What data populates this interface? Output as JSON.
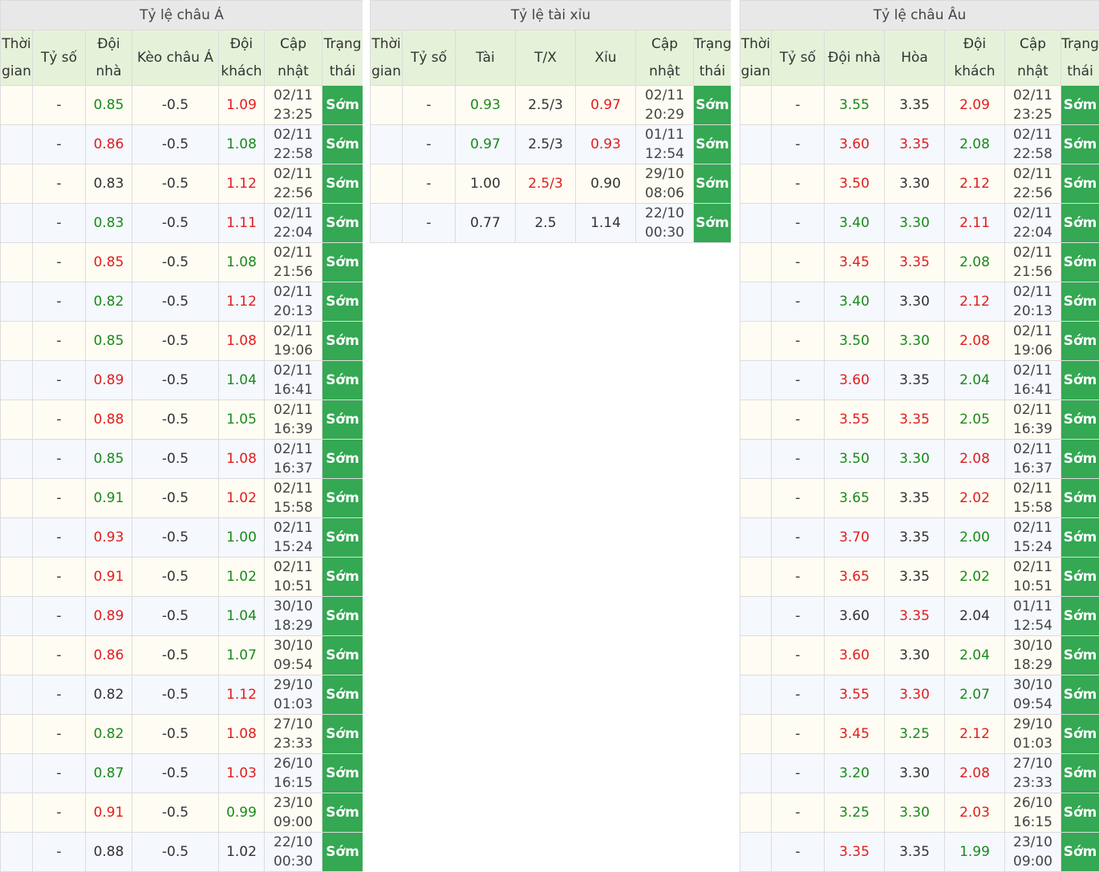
{
  "colors": {
    "green_value": "#1a8a1a",
    "red_value": "#e11d1d",
    "status_bg": "#34a853",
    "header_bg": "#e5f2d9",
    "title_bg": "#e8e8e8"
  },
  "asia": {
    "title": "Tỷ lệ châu Á",
    "headers": [
      "Thời gian",
      "Tỷ số",
      "Đội nhà",
      "Kèo châu Á",
      "Đội khách",
      "Cập nhật",
      "Trạng thái"
    ],
    "rows": [
      {
        "time": "",
        "score": "-",
        "home": "0.85",
        "home_c": "g",
        "line": "-0.5",
        "away": "1.09",
        "away_c": "r",
        "upd": [
          "02/11",
          "23:25"
        ],
        "status": "Sớm"
      },
      {
        "time": "",
        "score": "-",
        "home": "0.86",
        "home_c": "r",
        "line": "-0.5",
        "away": "1.08",
        "away_c": "g",
        "upd": [
          "02/11",
          "22:58"
        ],
        "status": "Sớm"
      },
      {
        "time": "",
        "score": "-",
        "home": "0.83",
        "home_c": "n",
        "line": "-0.5",
        "away": "1.12",
        "away_c": "r",
        "upd": [
          "02/11",
          "22:56"
        ],
        "status": "Sớm"
      },
      {
        "time": "",
        "score": "-",
        "home": "0.83",
        "home_c": "g",
        "line": "-0.5",
        "away": "1.11",
        "away_c": "r",
        "upd": [
          "02/11",
          "22:04"
        ],
        "status": "Sớm"
      },
      {
        "time": "",
        "score": "-",
        "home": "0.85",
        "home_c": "r",
        "line": "-0.5",
        "away": "1.08",
        "away_c": "g",
        "upd": [
          "02/11",
          "21:56"
        ],
        "status": "Sớm"
      },
      {
        "time": "",
        "score": "-",
        "home": "0.82",
        "home_c": "g",
        "line": "-0.5",
        "away": "1.12",
        "away_c": "r",
        "upd": [
          "02/11",
          "20:13"
        ],
        "status": "Sớm"
      },
      {
        "time": "",
        "score": "-",
        "home": "0.85",
        "home_c": "g",
        "line": "-0.5",
        "away": "1.08",
        "away_c": "r",
        "upd": [
          "02/11",
          "19:06"
        ],
        "status": "Sớm"
      },
      {
        "time": "",
        "score": "-",
        "home": "0.89",
        "home_c": "r",
        "line": "-0.5",
        "away": "1.04",
        "away_c": "g",
        "upd": [
          "02/11",
          "16:41"
        ],
        "status": "Sớm"
      },
      {
        "time": "",
        "score": "-",
        "home": "0.88",
        "home_c": "r",
        "line": "-0.5",
        "away": "1.05",
        "away_c": "g",
        "upd": [
          "02/11",
          "16:39"
        ],
        "status": "Sớm"
      },
      {
        "time": "",
        "score": "-",
        "home": "0.85",
        "home_c": "g",
        "line": "-0.5",
        "away": "1.08",
        "away_c": "r",
        "upd": [
          "02/11",
          "16:37"
        ],
        "status": "Sớm"
      },
      {
        "time": "",
        "score": "-",
        "home": "0.91",
        "home_c": "g",
        "line": "-0.5",
        "away": "1.02",
        "away_c": "r",
        "upd": [
          "02/11",
          "15:58"
        ],
        "status": "Sớm"
      },
      {
        "time": "",
        "score": "-",
        "home": "0.93",
        "home_c": "r",
        "line": "-0.5",
        "away": "1.00",
        "away_c": "g",
        "upd": [
          "02/11",
          "15:24"
        ],
        "status": "Sớm"
      },
      {
        "time": "",
        "score": "-",
        "home": "0.91",
        "home_c": "r",
        "line": "-0.5",
        "away": "1.02",
        "away_c": "g",
        "upd": [
          "02/11",
          "10:51"
        ],
        "status": "Sớm"
      },
      {
        "time": "",
        "score": "-",
        "home": "0.89",
        "home_c": "r",
        "line": "-0.5",
        "away": "1.04",
        "away_c": "g",
        "upd": [
          "30/10",
          "18:29"
        ],
        "status": "Sớm"
      },
      {
        "time": "",
        "score": "-",
        "home": "0.86",
        "home_c": "r",
        "line": "-0.5",
        "away": "1.07",
        "away_c": "g",
        "upd": [
          "30/10",
          "09:54"
        ],
        "status": "Sớm"
      },
      {
        "time": "",
        "score": "-",
        "home": "0.82",
        "home_c": "n",
        "line": "-0.5",
        "away": "1.12",
        "away_c": "r",
        "upd": [
          "29/10",
          "01:03"
        ],
        "status": "Sớm"
      },
      {
        "time": "",
        "score": "-",
        "home": "0.82",
        "home_c": "g",
        "line": "-0.5",
        "away": "1.08",
        "away_c": "r",
        "upd": [
          "27/10",
          "23:33"
        ],
        "status": "Sớm"
      },
      {
        "time": "",
        "score": "-",
        "home": "0.87",
        "home_c": "g",
        "line": "-0.5",
        "away": "1.03",
        "away_c": "r",
        "upd": [
          "26/10",
          "16:15"
        ],
        "status": "Sớm"
      },
      {
        "time": "",
        "score": "-",
        "home": "0.91",
        "home_c": "r",
        "line": "-0.5",
        "away": "0.99",
        "away_c": "g",
        "upd": [
          "23/10",
          "09:00"
        ],
        "status": "Sớm"
      },
      {
        "time": "",
        "score": "-",
        "home": "0.88",
        "home_c": "n",
        "line": "-0.5",
        "away": "1.02",
        "away_c": "n",
        "upd": [
          "22/10",
          "00:30"
        ],
        "status": "Sớm"
      }
    ]
  },
  "ou": {
    "title": "Tỷ lệ tài xỉu",
    "headers": [
      "Thời gian",
      "Tỷ số",
      "Tài",
      "T/X",
      "Xỉu",
      "Cập nhật",
      "Trạng thái"
    ],
    "rows": [
      {
        "time": "",
        "score": "-",
        "over": "0.93",
        "over_c": "g",
        "line": "2.5/3",
        "line_c": "n",
        "under": "0.97",
        "under_c": "r",
        "upd": [
          "02/11",
          "20:29"
        ],
        "status": "Sớm"
      },
      {
        "time": "",
        "score": "-",
        "over": "0.97",
        "over_c": "g",
        "line": "2.5/3",
        "line_c": "n",
        "under": "0.93",
        "under_c": "r",
        "upd": [
          "01/11",
          "12:54"
        ],
        "status": "Sớm"
      },
      {
        "time": "",
        "score": "-",
        "over": "1.00",
        "over_c": "n",
        "line": "2.5/3",
        "line_c": "r",
        "under": "0.90",
        "under_c": "n",
        "upd": [
          "29/10",
          "08:06"
        ],
        "status": "Sớm"
      },
      {
        "time": "",
        "score": "-",
        "over": "0.77",
        "over_c": "n",
        "line": "2.5",
        "line_c": "n",
        "under": "1.14",
        "under_c": "n",
        "upd": [
          "22/10",
          "00:30"
        ],
        "status": "Sớm"
      }
    ]
  },
  "eu": {
    "title": "Tỷ lệ châu Âu",
    "headers": [
      "Thời gian",
      "Tỷ số",
      "Đội nhà",
      "Hòa",
      "Đội khách",
      "Cập nhật",
      "Trạng thái"
    ],
    "rows": [
      {
        "time": "",
        "score": "-",
        "home": "3.55",
        "home_c": "g",
        "draw": "3.35",
        "draw_c": "n",
        "away": "2.09",
        "away_c": "r",
        "upd": [
          "02/11",
          "23:25"
        ],
        "status": "Sớm"
      },
      {
        "time": "",
        "score": "-",
        "home": "3.60",
        "home_c": "r",
        "draw": "3.35",
        "draw_c": "r",
        "away": "2.08",
        "away_c": "g",
        "upd": [
          "02/11",
          "22:58"
        ],
        "status": "Sớm"
      },
      {
        "time": "",
        "score": "-",
        "home": "3.50",
        "home_c": "r",
        "draw": "3.30",
        "draw_c": "n",
        "away": "2.12",
        "away_c": "r",
        "upd": [
          "02/11",
          "22:56"
        ],
        "status": "Sớm"
      },
      {
        "time": "",
        "score": "-",
        "home": "3.40",
        "home_c": "g",
        "draw": "3.30",
        "draw_c": "g",
        "away": "2.11",
        "away_c": "r",
        "upd": [
          "02/11",
          "22:04"
        ],
        "status": "Sớm"
      },
      {
        "time": "",
        "score": "-",
        "home": "3.45",
        "home_c": "r",
        "draw": "3.35",
        "draw_c": "r",
        "away": "2.08",
        "away_c": "g",
        "upd": [
          "02/11",
          "21:56"
        ],
        "status": "Sớm"
      },
      {
        "time": "",
        "score": "-",
        "home": "3.40",
        "home_c": "g",
        "draw": "3.30",
        "draw_c": "n",
        "away": "2.12",
        "away_c": "r",
        "upd": [
          "02/11",
          "20:13"
        ],
        "status": "Sớm"
      },
      {
        "time": "",
        "score": "-",
        "home": "3.50",
        "home_c": "g",
        "draw": "3.30",
        "draw_c": "g",
        "away": "2.08",
        "away_c": "r",
        "upd": [
          "02/11",
          "19:06"
        ],
        "status": "Sớm"
      },
      {
        "time": "",
        "score": "-",
        "home": "3.60",
        "home_c": "r",
        "draw": "3.35",
        "draw_c": "n",
        "away": "2.04",
        "away_c": "g",
        "upd": [
          "02/11",
          "16:41"
        ],
        "status": "Sớm"
      },
      {
        "time": "",
        "score": "-",
        "home": "3.55",
        "home_c": "r",
        "draw": "3.35",
        "draw_c": "r",
        "away": "2.05",
        "away_c": "g",
        "upd": [
          "02/11",
          "16:39"
        ],
        "status": "Sớm"
      },
      {
        "time": "",
        "score": "-",
        "home": "3.50",
        "home_c": "g",
        "draw": "3.30",
        "draw_c": "g",
        "away": "2.08",
        "away_c": "r",
        "upd": [
          "02/11",
          "16:37"
        ],
        "status": "Sớm"
      },
      {
        "time": "",
        "score": "-",
        "home": "3.65",
        "home_c": "g",
        "draw": "3.35",
        "draw_c": "n",
        "away": "2.02",
        "away_c": "r",
        "upd": [
          "02/11",
          "15:58"
        ],
        "status": "Sớm"
      },
      {
        "time": "",
        "score": "-",
        "home": "3.70",
        "home_c": "r",
        "draw": "3.35",
        "draw_c": "n",
        "away": "2.00",
        "away_c": "g",
        "upd": [
          "02/11",
          "15:24"
        ],
        "status": "Sớm"
      },
      {
        "time": "",
        "score": "-",
        "home": "3.65",
        "home_c": "r",
        "draw": "3.35",
        "draw_c": "n",
        "away": "2.02",
        "away_c": "g",
        "upd": [
          "02/11",
          "10:51"
        ],
        "status": "Sớm"
      },
      {
        "time": "",
        "score": "-",
        "home": "3.60",
        "home_c": "n",
        "draw": "3.35",
        "draw_c": "r",
        "away": "2.04",
        "away_c": "n",
        "upd": [
          "01/11",
          "12:54"
        ],
        "status": "Sớm"
      },
      {
        "time": "",
        "score": "-",
        "home": "3.60",
        "home_c": "r",
        "draw": "3.30",
        "draw_c": "n",
        "away": "2.04",
        "away_c": "g",
        "upd": [
          "30/10",
          "18:29"
        ],
        "status": "Sớm"
      },
      {
        "time": "",
        "score": "-",
        "home": "3.55",
        "home_c": "r",
        "draw": "3.30",
        "draw_c": "r",
        "away": "2.07",
        "away_c": "g",
        "upd": [
          "30/10",
          "09:54"
        ],
        "status": "Sớm"
      },
      {
        "time": "",
        "score": "-",
        "home": "3.45",
        "home_c": "r",
        "draw": "3.25",
        "draw_c": "g",
        "away": "2.12",
        "away_c": "r",
        "upd": [
          "29/10",
          "01:03"
        ],
        "status": "Sớm"
      },
      {
        "time": "",
        "score": "-",
        "home": "3.20",
        "home_c": "g",
        "draw": "3.30",
        "draw_c": "n",
        "away": "2.08",
        "away_c": "r",
        "upd": [
          "27/10",
          "23:33"
        ],
        "status": "Sớm"
      },
      {
        "time": "",
        "score": "-",
        "home": "3.25",
        "home_c": "g",
        "draw": "3.30",
        "draw_c": "g",
        "away": "2.03",
        "away_c": "r",
        "upd": [
          "26/10",
          "16:15"
        ],
        "status": "Sớm"
      },
      {
        "time": "",
        "score": "-",
        "home": "3.35",
        "home_c": "r",
        "draw": "3.35",
        "draw_c": "n",
        "away": "1.99",
        "away_c": "g",
        "upd": [
          "23/10",
          "09:00"
        ],
        "status": "Sớm"
      }
    ]
  }
}
